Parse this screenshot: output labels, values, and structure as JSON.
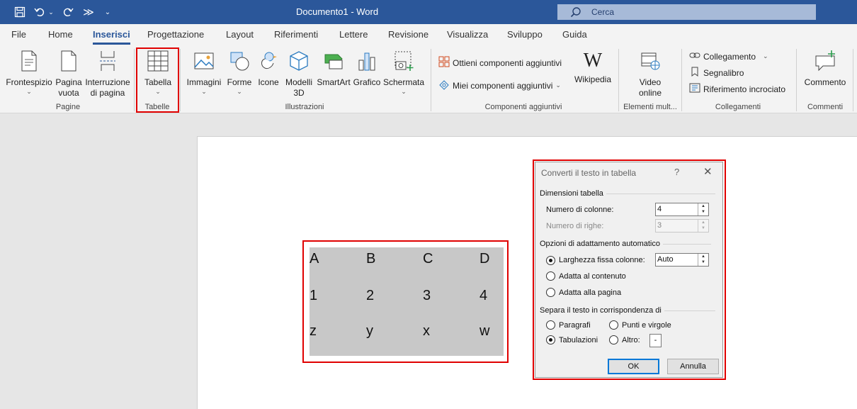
{
  "window": {
    "title": "Documento1  -  Word",
    "search_placeholder": "Cerca"
  },
  "tabs": [
    "File",
    "Home",
    "Inserisci",
    "Progettazione",
    "Layout",
    "Riferimenti",
    "Lettere",
    "Revisione",
    "Visualizza",
    "Sviluppo",
    "Guida"
  ],
  "active_tab": "Inserisci",
  "ribbon": {
    "pagine": {
      "frontespizio": "Frontespizio",
      "pagina_vuota_1": "Pagina",
      "pagina_vuota_2": "vuota",
      "interruzione_1": "Interruzione",
      "interruzione_2": "di pagina",
      "label": "Pagine"
    },
    "tabelle": {
      "tabella": "Tabella",
      "label": "Tabelle"
    },
    "illustrazioni": {
      "immagini": "Immagini",
      "forme": "Forme",
      "icone": "Icone",
      "modelli_1": "Modelli",
      "modelli_2": "3D",
      "smartart": "SmartArt",
      "grafico": "Grafico",
      "schermata": "Schermata",
      "label": "Illustrazioni"
    },
    "componenti": {
      "ottieni": "Ottieni componenti aggiuntivi",
      "miei": "Miei componenti aggiuntivi",
      "wikipedia": "Wikipedia",
      "label": "Componenti aggiuntivi"
    },
    "elementi": {
      "video_1": "Video",
      "video_2": "online",
      "label": "Elementi mult..."
    },
    "collegamenti": {
      "collegamento": "Collegamento",
      "segnalibro": "Segnalibro",
      "riferimento": "Riferimento incrociato",
      "label": "Collegamenti"
    },
    "commenti": {
      "commento": "Commento",
      "label": "Commenti"
    }
  },
  "document": {
    "rows": [
      [
        "A",
        "B",
        "C",
        "D"
      ],
      [
        "1",
        "2",
        "3",
        "4"
      ],
      [
        "z",
        "y",
        "x",
        "w"
      ]
    ]
  },
  "dialog": {
    "title": "Converti il testo in tabella",
    "help": "?",
    "close": "✕",
    "dimensioni": {
      "heading": "Dimensioni tabella",
      "colonne_label": "Numero di colonne:",
      "colonne_value": "4",
      "righe_label": "Numero di righe:",
      "righe_value": "3"
    },
    "adattamento": {
      "heading": "Opzioni di adattamento automatico",
      "fissa_label": "Larghezza fissa colonne:",
      "fissa_value": "Auto",
      "contenuto_label": "Adatta al contenuto",
      "pagina_label": "Adatta alla pagina"
    },
    "separa": {
      "heading": "Separa il testo in corrispondenza di",
      "paragrafi": "Paragrafi",
      "punti": "Punti e virgole",
      "tabulazioni": "Tabulazioni",
      "altro": "Altro:",
      "altro_value": "-"
    },
    "ok": "OK",
    "annulla": "Annulla"
  },
  "colors": {
    "title_bar": "#2b579a",
    "highlight_box": "#e00000",
    "selection": "#c8c8c8"
  }
}
